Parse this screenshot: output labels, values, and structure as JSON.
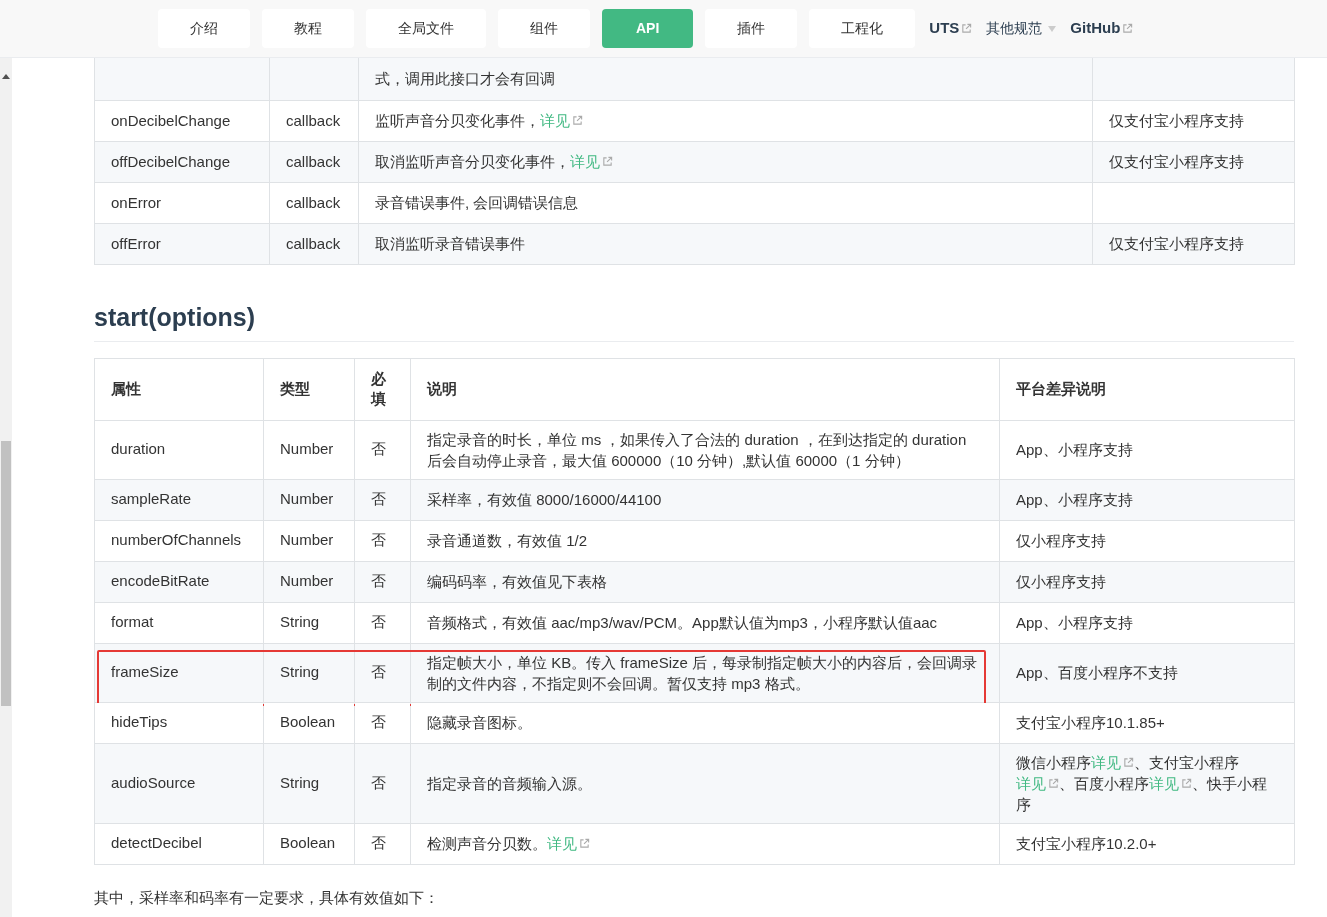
{
  "nav": {
    "items": [
      {
        "label": "介绍",
        "kind": "button",
        "selected": false
      },
      {
        "label": "教程",
        "kind": "button",
        "selected": false
      },
      {
        "label": "全局文件",
        "kind": "button",
        "selected": false
      },
      {
        "label": "组件",
        "kind": "button",
        "selected": false
      },
      {
        "label": "API",
        "kind": "button",
        "selected": true
      },
      {
        "label": "插件",
        "kind": "button",
        "selected": false
      },
      {
        "label": "工程化",
        "kind": "button",
        "selected": false
      },
      {
        "label": "UTS",
        "kind": "external",
        "selected": false
      },
      {
        "label": "其他规范",
        "kind": "dropdown",
        "selected": false
      },
      {
        "label": "GitHub",
        "kind": "external",
        "selected": false
      }
    ]
  },
  "events_table": {
    "rows": [
      {
        "name": "",
        "type": "",
        "description": [
          {
            "text": "式，调用此接口才会有回调",
            "link": false
          }
        ],
        "platform": []
      },
      {
        "name": "onDecibelChange",
        "type": "callback",
        "description": [
          {
            "text": "监听声音分贝变化事件，",
            "link": false
          },
          {
            "text": "详见",
            "link": true
          }
        ],
        "platform": [
          {
            "text": "仅支付宝小程序支持",
            "link": false
          }
        ]
      },
      {
        "name": "offDecibelChange",
        "type": "callback",
        "description": [
          {
            "text": "取消监听声音分贝变化事件，",
            "link": false
          },
          {
            "text": "详见",
            "link": true
          }
        ],
        "platform": [
          {
            "text": "仅支付宝小程序支持",
            "link": false
          }
        ]
      },
      {
        "name": "onError",
        "type": "callback",
        "description": [
          {
            "text": "录音错误事件, 会回调错误信息",
            "link": false
          }
        ],
        "platform": []
      },
      {
        "name": "offError",
        "type": "callback",
        "description": [
          {
            "text": "取消监听录音错误事件",
            "link": false
          }
        ],
        "platform": [
          {
            "text": "仅支付宝小程序支持",
            "link": false
          }
        ]
      }
    ]
  },
  "section": {
    "title": "start(options)"
  },
  "options_table": {
    "columns": [
      "属性",
      "类型",
      "必填",
      "说明",
      "平台差异说明"
    ],
    "rows": [
      {
        "name": "duration",
        "type": "Number",
        "required": "否",
        "highlighted": false,
        "description": [
          {
            "text": "指定录音的时长，单位 ms ，如果传入了合法的 duration ，在到达指定的 duration 后会自动停止录音，最大值 600000（10 分钟）,默认值 60000（1 分钟）",
            "link": false
          }
        ],
        "platform": [
          {
            "text": "App、小程序支持",
            "link": false
          }
        ]
      },
      {
        "name": "sampleRate",
        "type": "Number",
        "required": "否",
        "highlighted": false,
        "description": [
          {
            "text": "采样率，有效值 8000/16000/44100",
            "link": false
          }
        ],
        "platform": [
          {
            "text": "App、小程序支持",
            "link": false
          }
        ]
      },
      {
        "name": "numberOfChannels",
        "type": "Number",
        "required": "否",
        "highlighted": false,
        "description": [
          {
            "text": "录音通道数，有效值 1/2",
            "link": false
          }
        ],
        "platform": [
          {
            "text": "仅小程序支持",
            "link": false
          }
        ]
      },
      {
        "name": "encodeBitRate",
        "type": "Number",
        "required": "否",
        "highlighted": false,
        "description": [
          {
            "text": "编码码率，有效值见下表格",
            "link": false
          }
        ],
        "platform": [
          {
            "text": "仅小程序支持",
            "link": false
          }
        ]
      },
      {
        "name": "format",
        "type": "String",
        "required": "否",
        "highlighted": false,
        "description": [
          {
            "text": "音频格式，有效值 aac/mp3/wav/PCM。App默认值为mp3，小程序默认值aac",
            "link": false
          }
        ],
        "platform": [
          {
            "text": "App、小程序支持",
            "link": false
          }
        ]
      },
      {
        "name": "frameSize",
        "type": "String",
        "required": "否",
        "highlighted": true,
        "description": [
          {
            "text": "指定帧大小，单位 KB。传入 frameSize 后，每录制指定帧大小的内容后，会回调录制的文件内容，不指定则不会回调。暂仅支持 mp3 格式。",
            "link": false
          }
        ],
        "platform": [
          {
            "text": "App、百度小程序不支持",
            "link": false
          }
        ]
      },
      {
        "name": "hideTips",
        "type": "Boolean",
        "required": "否",
        "highlighted": false,
        "description": [
          {
            "text": "隐藏录音图标。",
            "link": false
          }
        ],
        "platform": [
          {
            "text": "支付宝小程序10.1.85+",
            "link": false
          }
        ]
      },
      {
        "name": "audioSource",
        "type": "String",
        "required": "否",
        "highlighted": false,
        "description": [
          {
            "text": "指定录音的音频输入源。",
            "link": false
          }
        ],
        "platform": [
          {
            "text": "微信小程序",
            "link": false
          },
          {
            "text": "详见",
            "link": true
          },
          {
            "text": "、支付宝小程序",
            "link": false
          },
          {
            "text": "详见",
            "link": true
          },
          {
            "text": "、百度小程序",
            "link": false
          },
          {
            "text": "详见",
            "link": true
          },
          {
            "text": "、快手小程序",
            "link": false
          }
        ]
      },
      {
        "name": "detectDecibel",
        "type": "Boolean",
        "required": "否",
        "highlighted": false,
        "description": [
          {
            "text": "检测声音分贝数。",
            "link": false
          },
          {
            "text": "详见",
            "link": true
          }
        ],
        "platform": [
          {
            "text": "支付宝小程序10.2.0+",
            "link": false
          }
        ]
      }
    ]
  },
  "footer_text": "其中，采样率和码率有一定要求，具体有效值如下："
}
